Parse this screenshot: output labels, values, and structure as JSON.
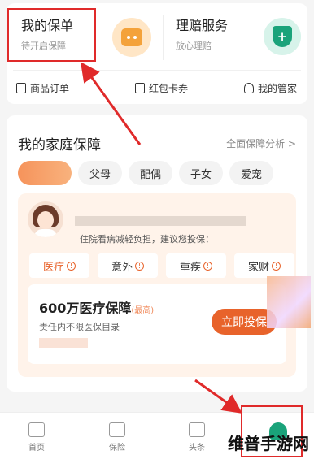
{
  "top": {
    "service_a": {
      "title": "我的保单",
      "subtitle": "待开启保障"
    },
    "service_b": {
      "title": "理赔服务",
      "subtitle": "放心理赔"
    },
    "quick": [
      "商品订单",
      "红包卡券",
      "我的管家"
    ]
  },
  "family": {
    "title": "我的家庭保障",
    "more": "全面保障分析 >",
    "chips": [
      "",
      "父母",
      "配偶",
      "子女",
      "爱宠"
    ],
    "advice": "住院看病减轻负担，建议您投保：",
    "tabs": [
      "医疗",
      "意外",
      "重疾",
      "家财"
    ],
    "offer": {
      "name": "600万医疗保障",
      "tag": "(最高)",
      "desc": "责任内不限医保目录",
      "button": "立即投保"
    }
  },
  "tabbar": [
    "首页",
    "保险",
    "头条",
    ""
  ],
  "watermark": "维普手游网",
  "colors": {
    "accent": "#e8632b",
    "highlight": "#e02a2a",
    "green": "#1aa37a"
  }
}
